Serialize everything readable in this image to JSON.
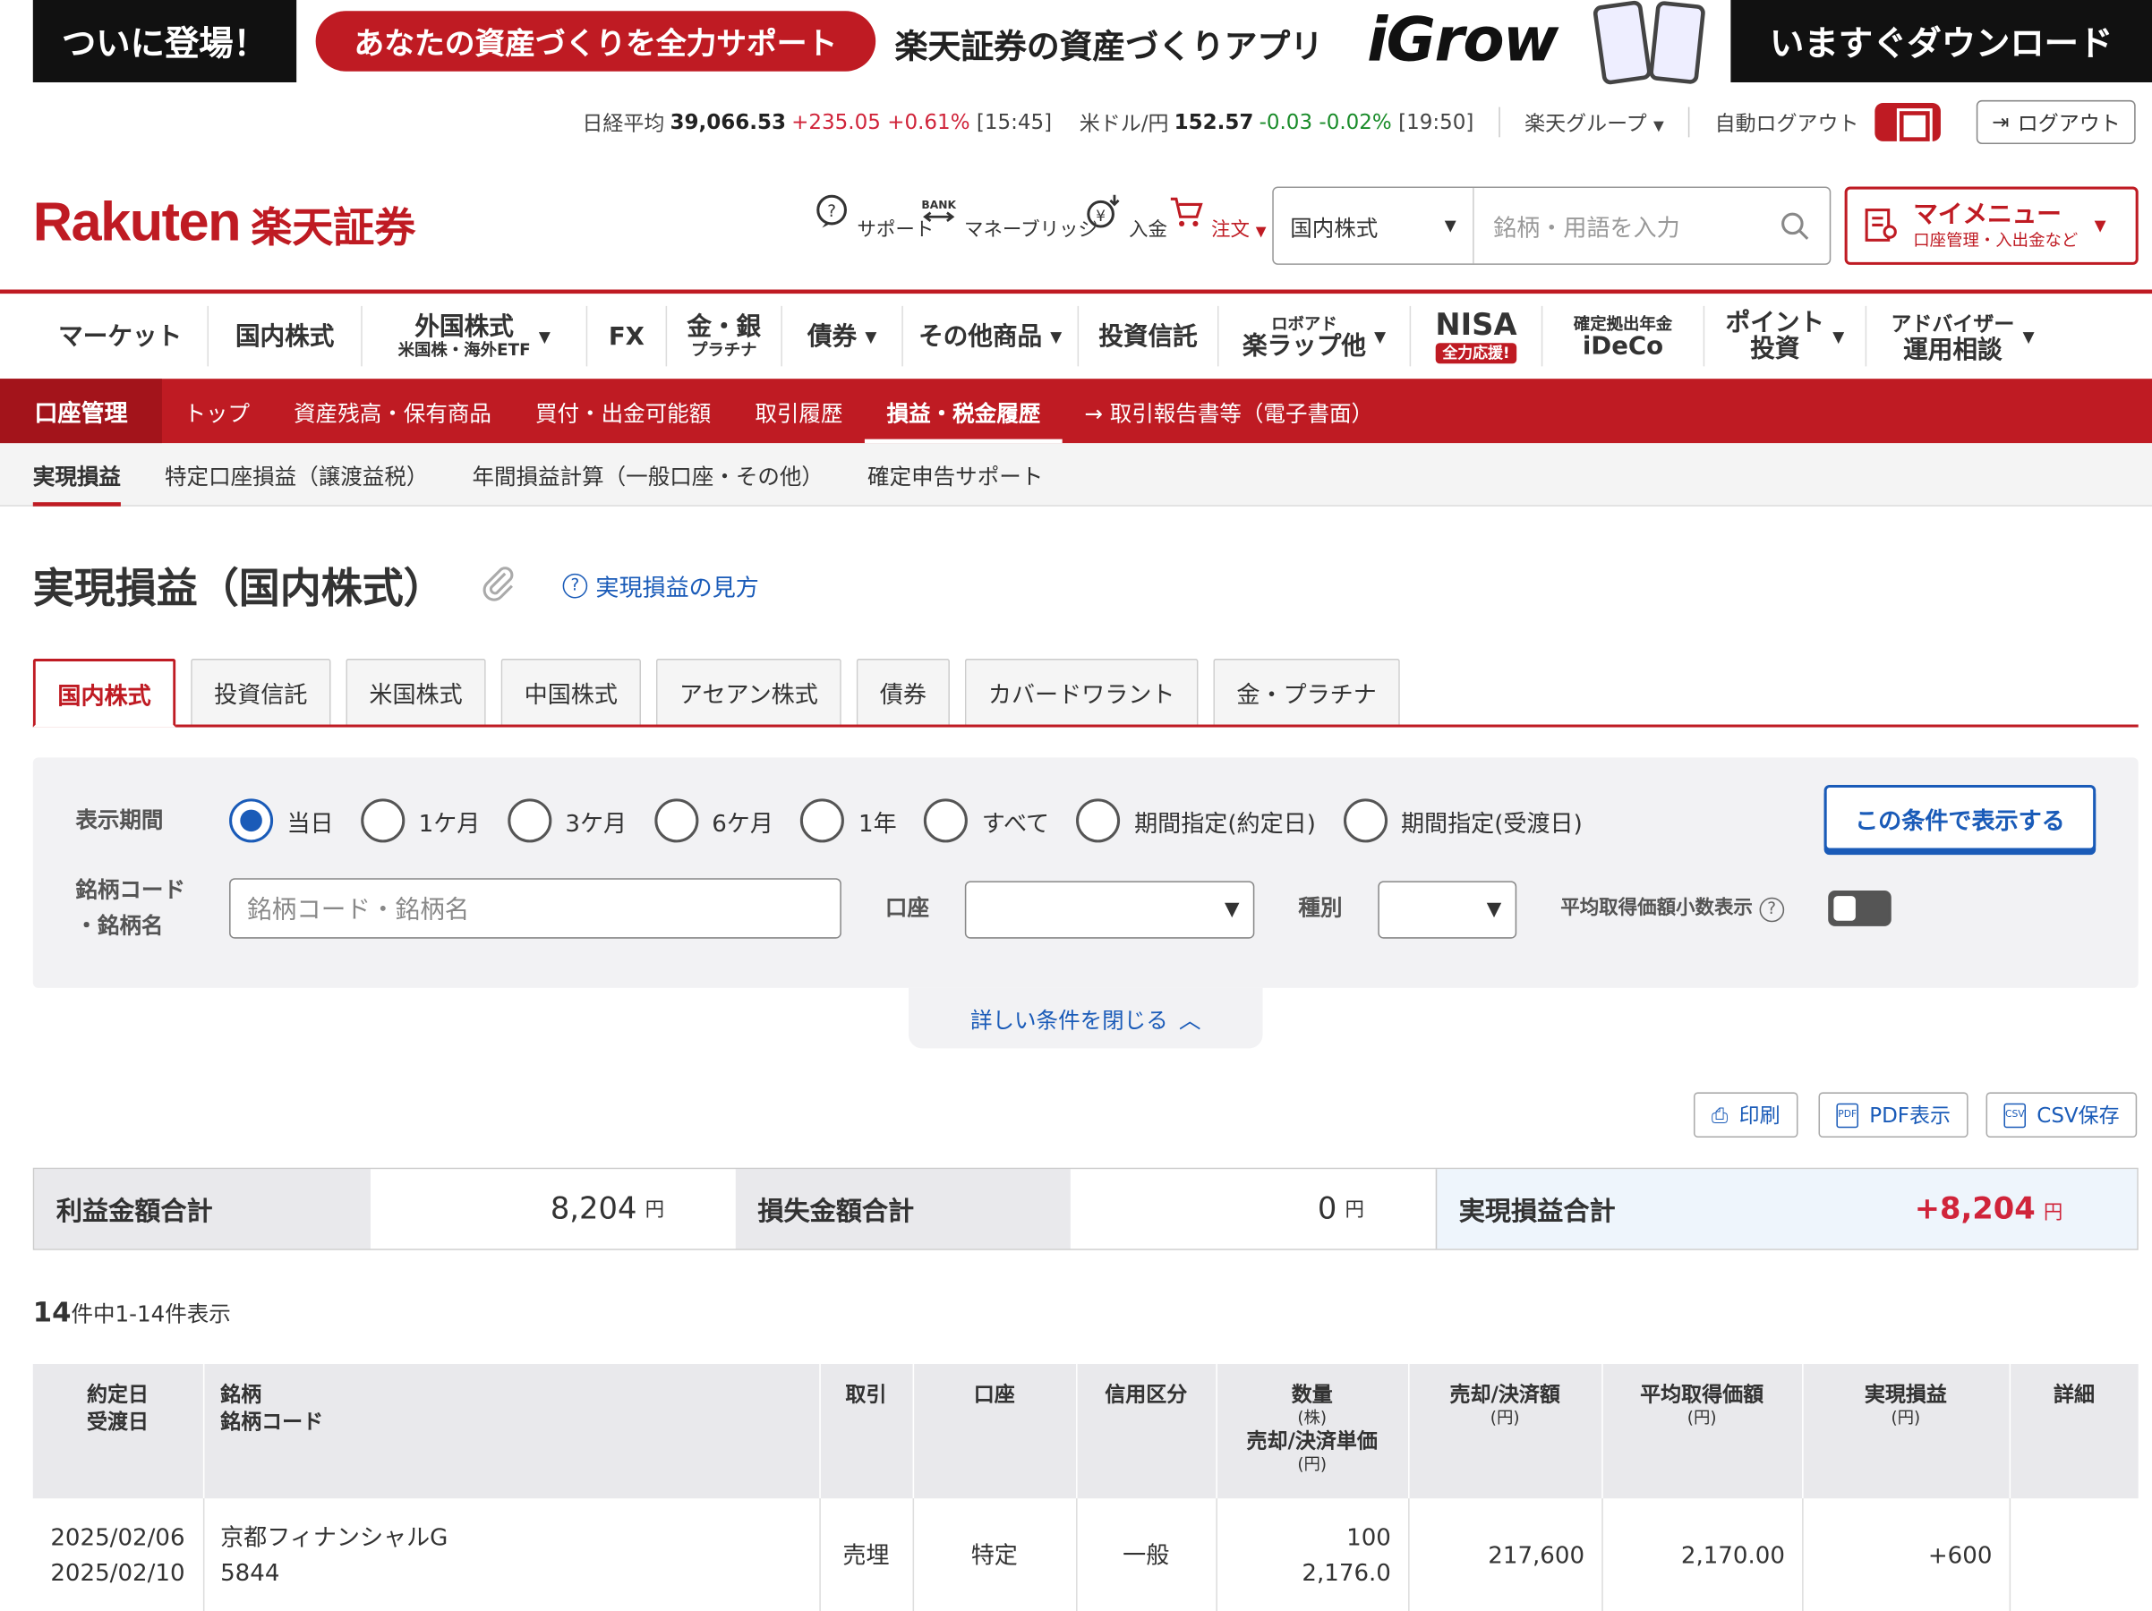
{
  "banner": {
    "left": "ついに登場！",
    "pill": "あなたの資産づくりを全力サポート",
    "mid": "楽天証券の資産づくりアプリ",
    "igrow": "iGrow",
    "right": "いますぐダウンロード"
  },
  "ticker": {
    "nikkei_label": "日経平均",
    "nikkei_value": "39,066.53",
    "nikkei_change": "+235.05",
    "nikkei_pct": "+0.61%",
    "nikkei_time": "[15:45]",
    "usd_label": "米ドル/円",
    "usd_value": "152.57",
    "usd_change": "-0.03",
    "usd_pct": "-0.02%",
    "usd_time": "[19:50]",
    "group": "楽天グループ",
    "auto_logout": "自動ログアウト",
    "logout": "ログアウト"
  },
  "header": {
    "logo_en": "Rakuten",
    "logo_jp": "楽天証券",
    "icons": [
      {
        "label": "サポート"
      },
      {
        "label": "マネーブリッジ"
      },
      {
        "label": "入金"
      },
      {
        "label": "注文"
      }
    ],
    "search_select": "国内株式",
    "search_placeholder": "銘柄・用語を入力",
    "mymenu_title": "マイメニュー",
    "mymenu_sub": "口座管理・入出金など"
  },
  "mainnav": [
    {
      "label": "マーケット"
    },
    {
      "label": "国内株式"
    },
    {
      "label": "外国株式",
      "sub": "米国株・海外ETF"
    },
    {
      "label": "FX"
    },
    {
      "label": "金・銀",
      "sub": "プラチナ"
    },
    {
      "label": "債券"
    },
    {
      "label": "その他商品"
    },
    {
      "label": "投資信託"
    },
    {
      "label": "楽ラップ他",
      "top": "ロボアド"
    },
    {
      "label": "NISA",
      "badge": "全力応援!"
    },
    {
      "label": "iDeCo",
      "top": "確定拠出年金"
    },
    {
      "label": "ポイント",
      "sub": "投資"
    },
    {
      "label": "アドバイザー",
      "sub": "運用相談"
    }
  ],
  "subnav": {
    "section": "口座管理",
    "items": [
      "トップ",
      "資産残高・保有商品",
      "買付・出金可能額",
      "取引履歴",
      "損益・税金履歴",
      "→ 取引報告書等（電子書面）"
    ]
  },
  "thirdnav": [
    "実現損益",
    "特定口座損益（譲渡益税）",
    "年間損益計算（一般口座・その他）",
    "確定申告サポート"
  ],
  "page": {
    "title": "実現損益（国内株式）",
    "help": "実現損益の見方"
  },
  "tabs": [
    "国内株式",
    "投資信託",
    "米国株式",
    "中国株式",
    "アセアン株式",
    "債券",
    "カバードワラント",
    "金・プラチナ"
  ],
  "filter": {
    "period_label": "表示期間",
    "periods": [
      "当日",
      "1ケ月",
      "3ケ月",
      "6ケ月",
      "1年",
      "すべて",
      "期間指定(約定日)",
      "期間指定(受渡日)"
    ],
    "selected_period": "当日",
    "code_label_1": "銘柄コード",
    "code_label_2": "・銘柄名",
    "code_placeholder": "銘柄コード・銘柄名",
    "account_label": "口座",
    "type_label": "種別",
    "decimal_label": "平均取得価額小数表示",
    "decimal_on": false,
    "show_button": "この条件で表示する",
    "close_link": "詳しい条件を閉じる"
  },
  "actions": {
    "print": "印刷",
    "pdf": "PDF表示",
    "csv": "CSV保存"
  },
  "summary": {
    "profit_label": "利益金額合計",
    "profit_value": "8,204",
    "loss_label": "損失金額合計",
    "loss_value": "0",
    "total_label": "実現損益合計",
    "total_value": "+8,204",
    "yen": "円"
  },
  "count": {
    "total": "14",
    "text": "件中1-14件表示"
  },
  "table": {
    "headers": {
      "date1": "約定日",
      "date2": "受渡日",
      "name1": "銘柄",
      "name2": "銘柄コード",
      "trade": "取引",
      "account": "口座",
      "credit": "信用区分",
      "qty": "数量",
      "qty_unit": "(株)",
      "qty2": "売却/決済単価",
      "qty2_unit": "(円)",
      "amount": "売却/決済額",
      "amount_unit": "(円)",
      "avg": "平均取得価額",
      "avg_unit": "(円)",
      "pl": "実現損益",
      "pl_unit": "(円)",
      "detail": "詳細"
    },
    "rows": [
      {
        "date1": "2025/02/06",
        "date2": "2025/02/10",
        "name": "京都フィナンシャルG",
        "code": "5844",
        "trade": "売埋",
        "account": "特定",
        "credit": "一般",
        "qty": "100",
        "price": "2,176.0",
        "amount": "217,600",
        "avg": "2,170.00",
        "pl": "+600"
      }
    ]
  }
}
